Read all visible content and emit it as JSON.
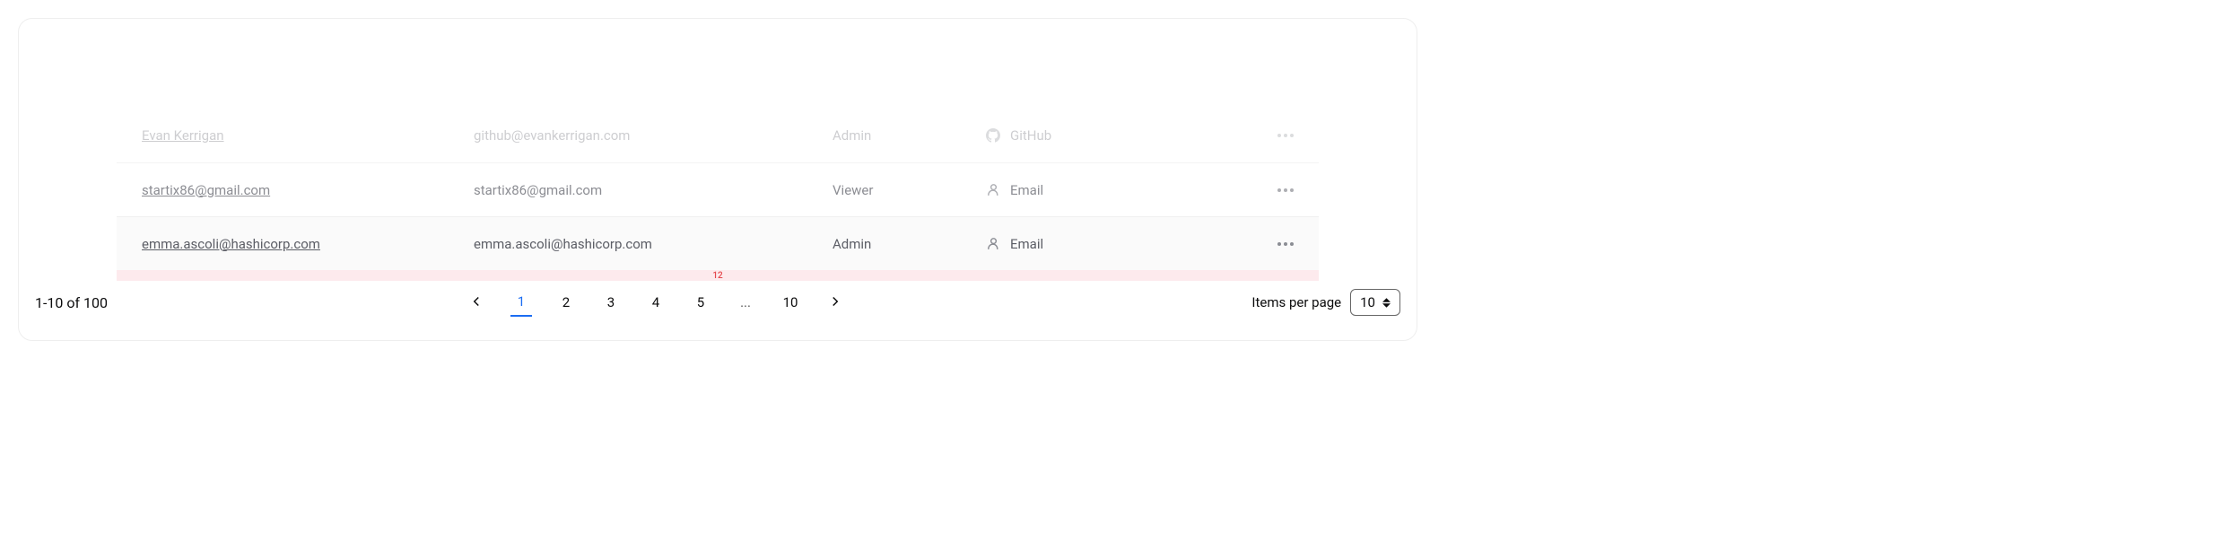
{
  "rows": [
    {
      "name": "Evan Kerrigan",
      "email": "github@evankerrigan.com",
      "role": "Admin",
      "provider_icon": "github-icon",
      "provider_label": "GitHub"
    },
    {
      "name": "startix86@gmail.com",
      "email": "startix86@gmail.com",
      "role": "Viewer",
      "provider_icon": "user-icon",
      "provider_label": "Email"
    },
    {
      "name": "emma.ascoli@hashicorp.com",
      "email": "emma.ascoli@hashicorp.com",
      "role": "Admin",
      "provider_icon": "user-icon",
      "provider_label": "Email"
    }
  ],
  "spacing_label": "12",
  "pagination": {
    "range_text": "1-10 of 100",
    "pages": [
      "1",
      "2",
      "3",
      "4",
      "5",
      "...",
      "10"
    ],
    "active_page": "1",
    "items_per_page_label": "Items per page",
    "items_per_page_value": "10"
  }
}
